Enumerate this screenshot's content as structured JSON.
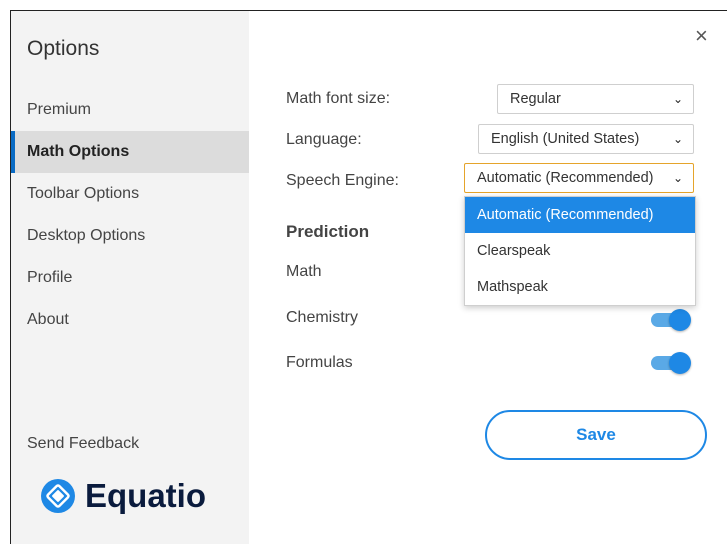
{
  "sidebar": {
    "title": "Options",
    "items": [
      {
        "label": "Premium"
      },
      {
        "label": "Math Options"
      },
      {
        "label": "Toolbar Options"
      },
      {
        "label": "Desktop Options"
      },
      {
        "label": "Profile"
      },
      {
        "label": "About"
      }
    ],
    "active_item": "Math Options",
    "feedback_label": "Send Feedback",
    "logo_text": "Equatio"
  },
  "close_symbol": "×",
  "settings": {
    "font_size": {
      "label": "Math font size:",
      "value": "Regular"
    },
    "language": {
      "label": "Language:",
      "value": "English (United States)"
    },
    "speech_engine": {
      "label": "Speech Engine:",
      "value": "Automatic (Recommended)",
      "options": [
        "Automatic (Recommended)",
        "Clearspeak",
        "Mathspeak"
      ]
    }
  },
  "prediction": {
    "heading": "Prediction",
    "toggles": [
      {
        "label": "Math",
        "on": true
      },
      {
        "label": "Chemistry",
        "on": true
      },
      {
        "label": "Formulas",
        "on": true
      }
    ]
  },
  "save_label": "Save",
  "colors": {
    "accent": "#1e88e5",
    "toggle_track": "#5aa9e6",
    "active_border": "#0a6bc4",
    "focus_border": "#e5a42b",
    "logo_text": "#0a1b3d"
  },
  "icons": {
    "close": "close-icon",
    "chevron": "chevron-down-icon",
    "logo": "equatio-logo-icon"
  }
}
